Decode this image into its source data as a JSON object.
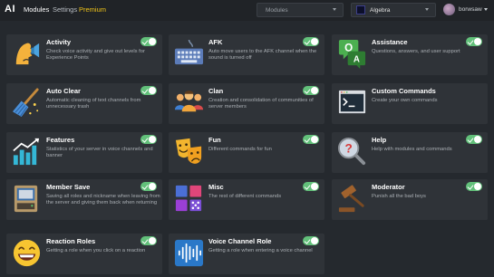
{
  "app": {
    "logo": "AI"
  },
  "nav": {
    "modules": "Modules",
    "settings": "Settings",
    "premium": "Premium"
  },
  "module_select": {
    "label": "Modules"
  },
  "server_select": {
    "label": "Algebra"
  },
  "user": {
    "name": "borwsaw"
  },
  "modules": [
    {
      "title": "Activity",
      "description": "Check voice activity and give out levels for Experience Points",
      "enabled": true,
      "icon": "megaphone-speaker-icon"
    },
    {
      "title": "AFK",
      "description": "Auto move users to the AFK channel when the sound is turned off",
      "enabled": true,
      "icon": "keyboard-icon"
    },
    {
      "title": "Assistance",
      "description": "Questions, answers, and user support",
      "enabled": true,
      "icon": "qa-bubbles-icon"
    },
    {
      "title": "Auto Clear",
      "description": "Automatic cleaning of text channels from unnecessary trash",
      "enabled": true,
      "icon": "broom-icon"
    },
    {
      "title": "Clan",
      "description": "Creation and consolidation of communities of server members",
      "enabled": true,
      "icon": "team-people-icon"
    },
    {
      "title": "Custom Commands",
      "description": "Create your own commands",
      "enabled": true,
      "icon": "terminal-icon"
    },
    {
      "title": "Features",
      "description": "Statistics of your server in voice channels and banner",
      "enabled": true,
      "icon": "bar-chart-icon"
    },
    {
      "title": "Fun",
      "description": "Different commands for fun",
      "enabled": true,
      "icon": "theater-masks-icon"
    },
    {
      "title": "Help",
      "description": "Help with modules and commands",
      "enabled": true,
      "icon": "help-magnifier-icon"
    },
    {
      "title": "Member Save",
      "description": "Saving all roles and nickname when leaving from the server and giving them back when returning",
      "enabled": true,
      "icon": "hard-drive-icon"
    },
    {
      "title": "Misc",
      "description": "The rest of different commands",
      "enabled": true,
      "icon": "misc-blocks-icon"
    },
    {
      "title": "Moderator",
      "description": "Punish all the bad boys",
      "enabled": true,
      "icon": "gavel-icon"
    },
    {
      "title": "Reaction Roles",
      "description": "Getting a role when you click on a reaction",
      "enabled": true,
      "icon": "grinning-face-icon"
    },
    {
      "title": "Voice Channel Role",
      "description": "Getting a role when entering a voice channel",
      "enabled": true,
      "icon": "sound-wave-icon"
    }
  ],
  "colors": {
    "background": "#25292e",
    "card": "#2f3338",
    "toggle_on": "#62c07a",
    "premium": "#f0c419"
  }
}
